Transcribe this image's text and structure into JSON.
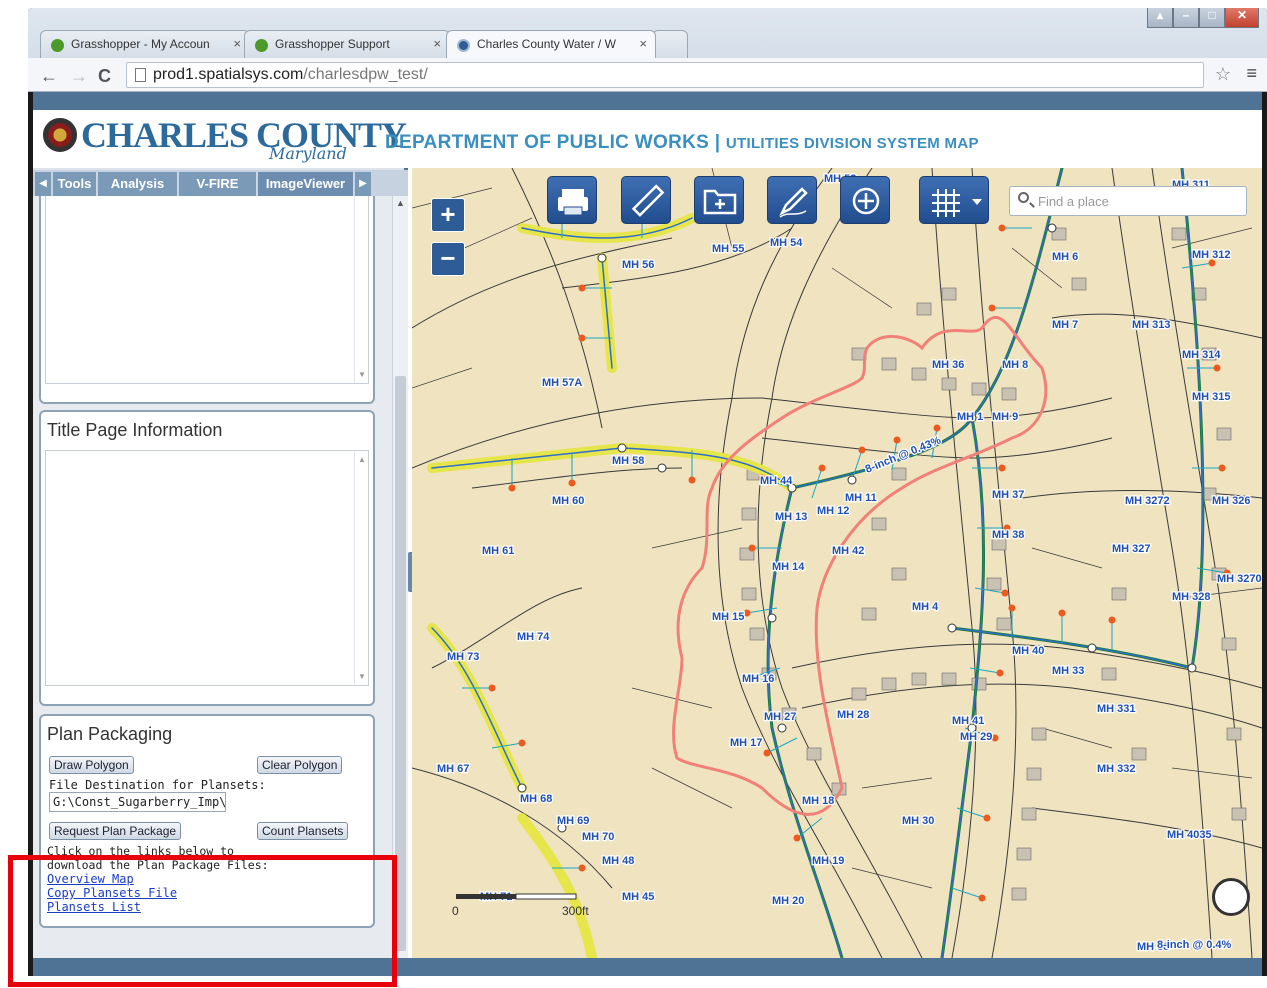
{
  "browser": {
    "tabs": [
      {
        "label": "Grasshopper - My Accoun",
        "close": "×"
      },
      {
        "label": "Grasshopper Support",
        "close": "×"
      },
      {
        "label": "Charles County Water / W",
        "close": "×"
      }
    ],
    "url_host": "prod1.spatialsys.com",
    "url_path": "/charlesdpw_test/"
  },
  "header": {
    "logo_main": "CHARLES COUNTY",
    "logo_script": "Maryland",
    "dept_title": "DEPARTMENT OF PUBLIC WORKS",
    "dept_separator": " | ",
    "dept_subtitle": "UTILITIES DIVISION SYSTEM MAP"
  },
  "sidebar": {
    "tabs": [
      "Tools",
      "Analysis",
      "V-FIRE",
      "ImageViewer"
    ],
    "active_tab": "ImageViewer",
    "title_page": {
      "heading": "Title Page Information"
    },
    "plan_packaging": {
      "heading": "Plan Packaging",
      "draw_polygon": "Draw Polygon",
      "clear_polygon": "Clear Polygon",
      "file_dest_label": "File Destination for Plansets:",
      "file_dest_value": "G:\\Const_Sugarberry_Imp\\",
      "request_plan": "Request Plan Package",
      "count_plansets": "Count Plansets",
      "instructions_line1": "Click on the links below to",
      "instructions_line2": "download the Plan Package Files:",
      "links": [
        "Overview Map",
        "Copy Plansets File",
        "Plansets List"
      ]
    }
  },
  "map": {
    "search_placeholder": "Find a place",
    "zoom_in": "+",
    "zoom_out": "−",
    "scale_left": "0",
    "scale_right": "300ft",
    "labels": [
      "MH 52",
      "MH 311",
      "MH 55",
      "MH 56",
      "MH 54",
      "MH 6",
      "MH 312",
      "MH 313",
      "MH 314",
      "MH 315",
      "MH 7",
      "MH 8",
      "MH 36",
      "MH 9",
      "MH 1",
      "MH 57A",
      "MH 58",
      "MH 44",
      "MH 11",
      "MH 12",
      "MH 13",
      "MH 37",
      "MH 3272",
      "MH 326",
      "MH 60",
      "MH 61",
      "MH 42",
      "MH 38",
      "MH 327",
      "MH 14",
      "MH 4",
      "MH 328",
      "MH 3270",
      "MH 74",
      "MH 73",
      "MH 15",
      "MH 40",
      "MH 33",
      "MH 16",
      "MH 28",
      "MH 41",
      "MH 331",
      "MH 27",
      "MH 17",
      "MH 29",
      "MH 332",
      "MH 67",
      "MH 68",
      "MH 69",
      "MH 70",
      "MH 18",
      "MH 30",
      "MH 4035",
      "MH 48",
      "MH 19",
      "MH 45",
      "MH 20",
      "MH 71",
      "MH 38"
    ],
    "pipe_labels": [
      "8-inch @ 0.43%",
      "8-inch @ 0.4%"
    ]
  },
  "colors": {
    "map_bg": "#efe3c0",
    "header_blue": "#4e7394",
    "dept_text": "#3a8fc0",
    "polygon_stroke": "#f08078",
    "highlight_box": "#e8000b"
  }
}
